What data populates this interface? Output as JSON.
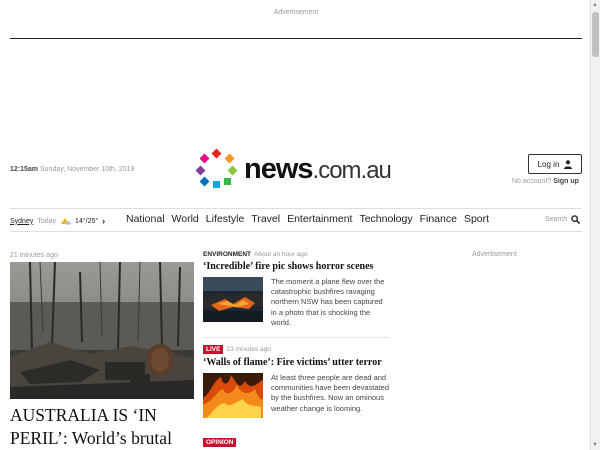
{
  "ads": {
    "top_label": "Advertisement",
    "side_label": "Advertisement"
  },
  "header": {
    "time": "12:15am",
    "date": "Sunday, November 10th, 2019",
    "logo_main": "news",
    "logo_suffix": ".com.au",
    "login_label": "Log in",
    "no_account_text": "No account?",
    "signup_label": "Sign up"
  },
  "weather": {
    "city": "Sydney",
    "day": "Today",
    "temps": "14°/25°",
    "icon": "partly-sunny-icon"
  },
  "nav": {
    "items": [
      "National",
      "World",
      "Lifestyle",
      "Travel",
      "Entertainment",
      "Technology",
      "Finance",
      "Sport"
    ]
  },
  "search": {
    "label": "Search"
  },
  "hero": {
    "time": "21 minutes ago",
    "headline": "AUSTRALIA IS ‘IN PERIL’: World’s brutal"
  },
  "stories": [
    {
      "tag": "ENVIRONMENT",
      "time": "About an hour ago",
      "title": "‘Incredible’ fire pic shows horror scenes",
      "snippet": "The moment a plane flew over the catastrophic bushfires ravaging northern NSW has been captured in a photo that is shocking the world."
    },
    {
      "badge": "LIVE",
      "time": "23 minutes ago",
      "title": "‘Walls of flame’: Fire victims’ utter terror",
      "snippet": "At least three people are dead and communities have been devastated by the bushfires. Now an ominous weather change is looming."
    },
    {
      "badge": "OPINION"
    }
  ],
  "colors": {
    "accent_red": "#c8102e",
    "logo_dots": [
      "#e2261c",
      "#f7941d",
      "#8dc63f",
      "#00a7e1",
      "#7f3f98",
      "#ec008c",
      "#0072bc",
      "#39b54a"
    ]
  }
}
